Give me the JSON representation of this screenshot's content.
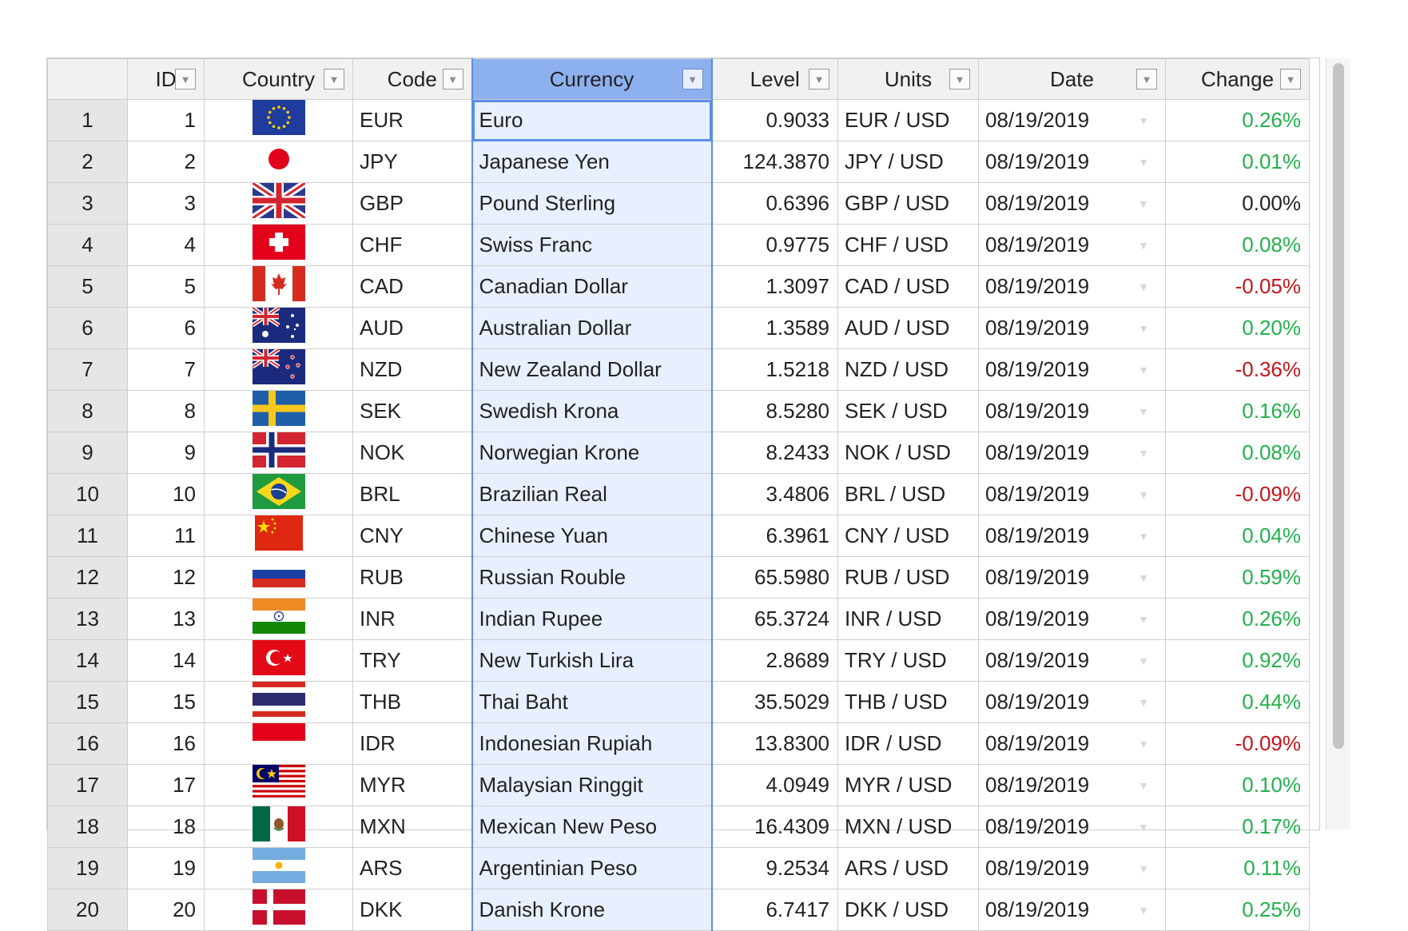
{
  "colors": {
    "positive": "#22b14c",
    "negative": "#c4161c",
    "selected_column": "#8db0ee",
    "selected_cells": "#e8efff"
  },
  "columns": [
    {
      "key": "id",
      "label": "ID"
    },
    {
      "key": "country",
      "label": "Country"
    },
    {
      "key": "code",
      "label": "Code"
    },
    {
      "key": "currency",
      "label": "Currency"
    },
    {
      "key": "level",
      "label": "Level"
    },
    {
      "key": "units",
      "label": "Units"
    },
    {
      "key": "date",
      "label": "Date"
    },
    {
      "key": "change",
      "label": "Change"
    }
  ],
  "rows": [
    {
      "row": "1",
      "id": "1",
      "flag": "eu-flag-icon",
      "code": "EUR",
      "currency": "Euro",
      "level": "0.9033",
      "units": "EUR / USD",
      "date": "08/19/2019",
      "change": "0.26%",
      "trend": "pos"
    },
    {
      "row": "2",
      "id": "2",
      "flag": "japan-flag-icon",
      "code": "JPY",
      "currency": "Japanese Yen",
      "level": "124.3870",
      "units": "JPY / USD",
      "date": "08/19/2019",
      "change": "0.01%",
      "trend": "pos"
    },
    {
      "row": "3",
      "id": "3",
      "flag": "uk-flag-icon",
      "code": "GBP",
      "currency": "Pound Sterling",
      "level": "0.6396",
      "units": "GBP / USD",
      "date": "08/19/2019",
      "change": "0.00%",
      "trend": "zero"
    },
    {
      "row": "4",
      "id": "4",
      "flag": "switzerland-flag-icon",
      "code": "CHF",
      "currency": "Swiss Franc",
      "level": "0.9775",
      "units": "CHF / USD",
      "date": "08/19/2019",
      "change": "0.08%",
      "trend": "pos"
    },
    {
      "row": "5",
      "id": "5",
      "flag": "canada-flag-icon",
      "code": "CAD",
      "currency": "Canadian Dollar",
      "level": "1.3097",
      "units": "CAD / USD",
      "date": "08/19/2019",
      "change": "-0.05%",
      "trend": "neg"
    },
    {
      "row": "6",
      "id": "6",
      "flag": "australia-flag-icon",
      "code": "AUD",
      "currency": "Australian Dollar",
      "level": "1.3589",
      "units": "AUD / USD",
      "date": "08/19/2019",
      "change": "0.20%",
      "trend": "pos"
    },
    {
      "row": "7",
      "id": "7",
      "flag": "new-zealand-flag-icon",
      "code": "NZD",
      "currency": "New Zealand Dollar",
      "level": "1.5218",
      "units": "NZD / USD",
      "date": "08/19/2019",
      "change": "-0.36%",
      "trend": "neg"
    },
    {
      "row": "8",
      "id": "8",
      "flag": "sweden-flag-icon",
      "code": "SEK",
      "currency": "Swedish Krona",
      "level": "8.5280",
      "units": "SEK / USD",
      "date": "08/19/2019",
      "change": "0.16%",
      "trend": "pos"
    },
    {
      "row": "9",
      "id": "9",
      "flag": "norway-flag-icon",
      "code": "NOK",
      "currency": "Norwegian Krone",
      "level": "8.2433",
      "units": "NOK / USD",
      "date": "08/19/2019",
      "change": "0.08%",
      "trend": "pos"
    },
    {
      "row": "10",
      "id": "10",
      "flag": "brazil-flag-icon",
      "code": "BRL",
      "currency": "Brazilian Real",
      "level": "3.4806",
      "units": "BRL / USD",
      "date": "08/19/2019",
      "change": "-0.09%",
      "trend": "neg"
    },
    {
      "row": "11",
      "id": "11",
      "flag": "china-flag-icon",
      "code": "CNY",
      "currency": "Chinese Yuan",
      "level": "6.3961",
      "units": "CNY / USD",
      "date": "08/19/2019",
      "change": "0.04%",
      "trend": "pos"
    },
    {
      "row": "12",
      "id": "12",
      "flag": "russia-flag-icon",
      "code": "RUB",
      "currency": "Russian Rouble",
      "level": "65.5980",
      "units": "RUB / USD",
      "date": "08/19/2019",
      "change": "0.59%",
      "trend": "pos"
    },
    {
      "row": "13",
      "id": "13",
      "flag": "india-flag-icon",
      "code": "INR",
      "currency": "Indian Rupee",
      "level": "65.3724",
      "units": "INR / USD",
      "date": "08/19/2019",
      "change": "0.26%",
      "trend": "pos"
    },
    {
      "row": "14",
      "id": "14",
      "flag": "turkey-flag-icon",
      "code": "TRY",
      "currency": "New Turkish Lira",
      "level": "2.8689",
      "units": "TRY / USD",
      "date": "08/19/2019",
      "change": "0.92%",
      "trend": "pos"
    },
    {
      "row": "15",
      "id": "15",
      "flag": "thailand-flag-icon",
      "code": "THB",
      "currency": "Thai Baht",
      "level": "35.5029",
      "units": "THB / USD",
      "date": "08/19/2019",
      "change": "0.44%",
      "trend": "pos"
    },
    {
      "row": "16",
      "id": "16",
      "flag": "indonesia-flag-icon",
      "code": "IDR",
      "currency": "Indonesian Rupiah",
      "level": "13.8300",
      "units": "IDR / USD",
      "date": "08/19/2019",
      "change": "-0.09%",
      "trend": "neg"
    },
    {
      "row": "17",
      "id": "17",
      "flag": "malaysia-flag-icon",
      "code": "MYR",
      "currency": "Malaysian Ringgit",
      "level": "4.0949",
      "units": "MYR / USD",
      "date": "08/19/2019",
      "change": "0.10%",
      "trend": "pos"
    },
    {
      "row": "18",
      "id": "18",
      "flag": "mexico-flag-icon",
      "code": "MXN",
      "currency": "Mexican New Peso",
      "level": "16.4309",
      "units": "MXN / USD",
      "date": "08/19/2019",
      "change": "0.17%",
      "trend": "pos"
    },
    {
      "row": "19",
      "id": "19",
      "flag": "argentina-flag-icon",
      "code": "ARS",
      "currency": "Argentinian Peso",
      "level": "9.2534",
      "units": "ARS / USD",
      "date": "08/19/2019",
      "change": "0.11%",
      "trend": "pos"
    },
    {
      "row": "20",
      "id": "20",
      "flag": "denmark-flag-icon",
      "code": "DKK",
      "currency": "Danish Krone",
      "level": "6.7417",
      "units": "DKK / USD",
      "date": "08/19/2019",
      "change": "0.25%",
      "trend": "pos"
    }
  ]
}
